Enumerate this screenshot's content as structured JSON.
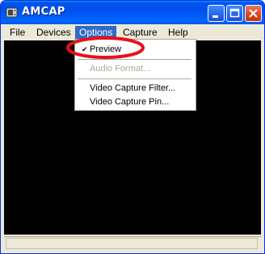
{
  "window": {
    "title": "AMCAP"
  },
  "menubar": {
    "file": "File",
    "devices": "Devices",
    "options": "Options",
    "capture": "Capture",
    "help": "Help"
  },
  "options_menu": {
    "preview": "Preview",
    "audio_format": "Audio Format...",
    "video_capture_filter": "Video Capture Filter...",
    "video_capture_pin": "Video Capture Pin..."
  },
  "status": {
    "text": ""
  },
  "colors": {
    "highlight": "#316ac5",
    "annotation": "#e8101a"
  }
}
